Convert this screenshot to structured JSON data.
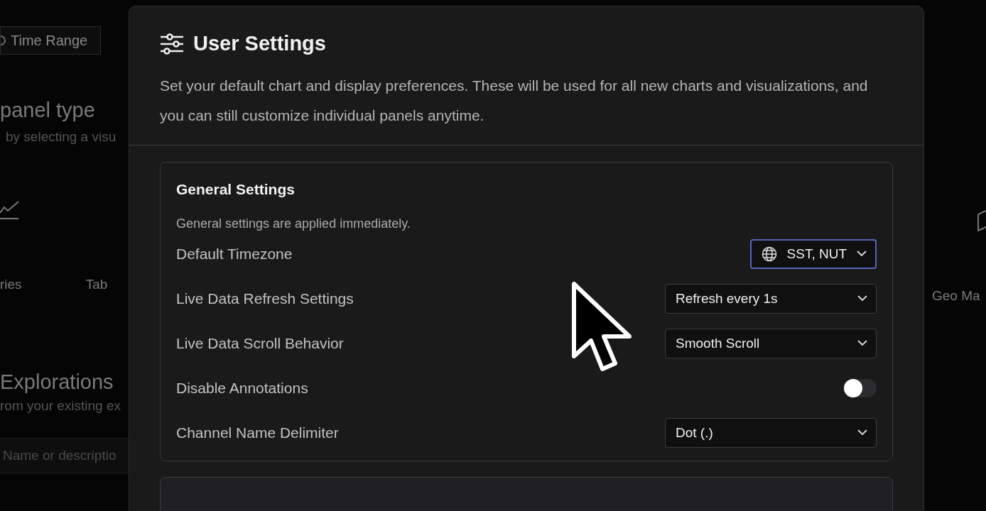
{
  "background": {
    "time_range_button": "Time Range",
    "panel_heading": "panel type",
    "panel_subtitle": "by selecting a visu",
    "panel_types": [
      {
        "label": "ries"
      },
      {
        "label": "Tab"
      },
      {
        "label": "Geo Ma"
      }
    ],
    "explorations_heading": "Explorations",
    "explorations_subtitle": "rom your existing ex",
    "search": {
      "placeholder": "Name or descriptio"
    }
  },
  "dialog": {
    "title": "User Settings",
    "description": "Set your default chart and display preferences. These will be used for all new charts and visualizations, and you can still customize individual panels anytime.",
    "sections": [
      {
        "title": "General Settings",
        "note": "General settings are applied immediately.",
        "settings": [
          {
            "kind": "timezone",
            "label": "Default Timezone",
            "value": "SST, NUT",
            "focused": true
          },
          {
            "kind": "select",
            "label": "Live Data Refresh Settings",
            "value": "Refresh every 1s",
            "focused": false
          },
          {
            "kind": "select",
            "label": "Live Data Scroll Behavior",
            "value": "Smooth Scroll",
            "focused": false
          },
          {
            "kind": "toggle",
            "label": "Disable Annotations",
            "on": false
          },
          {
            "kind": "select",
            "label": "Channel Name Delimiter",
            "value": "Dot (.)",
            "focused": false
          }
        ]
      }
    ]
  }
}
